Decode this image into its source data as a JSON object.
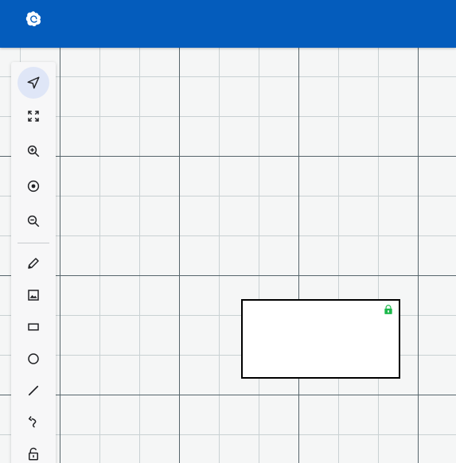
{
  "header": {
    "logo_icon": "app-logo-icon",
    "background_color": "#045cbc"
  },
  "toolbar": {
    "tools": [
      {
        "id": "select",
        "icon": "navigation-arrow-icon",
        "active": true
      },
      {
        "id": "fit",
        "icon": "fit-screen-icon",
        "active": false
      },
      {
        "id": "zoom-in",
        "icon": "zoom-in-icon",
        "active": false
      },
      {
        "id": "center",
        "icon": "center-focus-icon",
        "active": false
      },
      {
        "id": "zoom-out",
        "icon": "zoom-out-icon",
        "active": false
      },
      {
        "id": "pencil",
        "icon": "pencil-icon",
        "active": false
      },
      {
        "id": "image",
        "icon": "image-icon",
        "active": false
      },
      {
        "id": "rectangle",
        "icon": "rectangle-icon",
        "active": false
      },
      {
        "id": "circle",
        "icon": "circle-icon",
        "active": false
      },
      {
        "id": "line",
        "icon": "line-icon",
        "active": false
      },
      {
        "id": "arrow",
        "icon": "curved-arrow-icon",
        "active": false
      },
      {
        "id": "lock",
        "icon": "lock-icon",
        "active": false
      }
    ],
    "active_color": "#dfe6f7"
  },
  "canvas": {
    "shapes": [
      {
        "type": "rectangle",
        "locked": true,
        "lock_icon": "lock-badge-icon",
        "lock_color": "#1cb84b"
      }
    ],
    "grid_major_color": "#56656b",
    "grid_minor_color": "#c9d1d3"
  }
}
